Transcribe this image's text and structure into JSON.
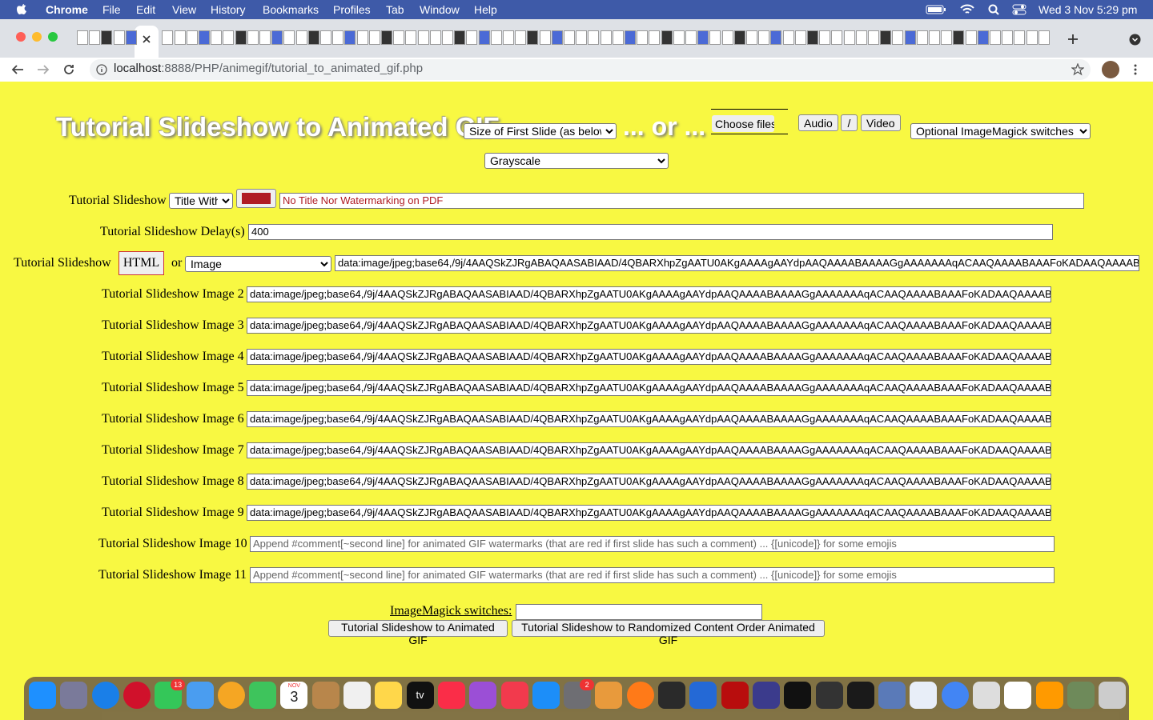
{
  "menubar": {
    "app": "Chrome",
    "items": [
      "File",
      "Edit",
      "View",
      "History",
      "Bookmarks",
      "Profiles",
      "Tab",
      "Window",
      "Help"
    ],
    "clock": "Wed 3 Nov  5:29 pm"
  },
  "browser": {
    "url_host": "localhost",
    "url_path": ":8888/PHP/animegif/tutorial_to_animated_gif.php"
  },
  "header": {
    "title": "Tutorial Slideshow to Animated GIF",
    "size_select": "Size of First Slide (as below)",
    "or_text": "... or ...",
    "choose_files": "Choose files",
    "audio": "Audio",
    "slash": "/",
    "video": "Video",
    "switches_select": "Optional ImageMagick switches ...",
    "effect_select": "Grayscale"
  },
  "form": {
    "title_row": {
      "label": "Tutorial Slideshow",
      "select": "Title With",
      "color": "#b01c24",
      "value": "No Title Nor Watermarking on PDF"
    },
    "delay_row": {
      "label": "Tutorial Slideshow Delay(s)",
      "value": "400"
    },
    "image1_row": {
      "label": "Tutorial Slideshow",
      "html_button": "HTML",
      "or": "or",
      "select": "Image",
      "value": "data:image/jpeg;base64,/9j/4AAQSkZJRgABAQAASABIAAD/4QBARXhpZgAATU0AKgAAAAgAAYdpAAQAAAABAAAAGgAAAAAAAqACAAQAAAABAAAFoKADAAQAAAABAAAA"
    },
    "image_rows": [
      {
        "label": "Tutorial Slideshow Image 2",
        "value": "data:image/jpeg;base64,/9j/4AAQSkZJRgABAQAASABIAAD/4QBARXhpZgAATU0AKgAAAAgAAYdpAAQAAAABAAAAGgAAAAAAAqACAAQAAAABAAAFoKADAAQAAAABAAAA"
      },
      {
        "label": "Tutorial Slideshow Image 3",
        "value": "data:image/jpeg;base64,/9j/4AAQSkZJRgABAQAASABIAAD/4QBARXhpZgAATU0AKgAAAAgAAYdpAAQAAAABAAAAGgAAAAAAAqACAAQAAAABAAAFoKADAAQAAAABAAAA"
      },
      {
        "label": "Tutorial Slideshow Image 4",
        "value": "data:image/jpeg;base64,/9j/4AAQSkZJRgABAQAASABIAAD/4QBARXhpZgAATU0AKgAAAAgAAYdpAAQAAAABAAAAGgAAAAAAAqACAAQAAAABAAAFoKADAAQAAAABAAAA"
      },
      {
        "label": "Tutorial Slideshow Image 5",
        "value": "data:image/jpeg;base64,/9j/4AAQSkZJRgABAQAASABIAAD/4QBARXhpZgAATU0AKgAAAAgAAYdpAAQAAAABAAAAGgAAAAAAAqACAAQAAAABAAAFoKADAAQAAAABAAAA"
      },
      {
        "label": "Tutorial Slideshow Image 6",
        "value": "data:image/jpeg;base64,/9j/4AAQSkZJRgABAQAASABIAAD/4QBARXhpZgAATU0AKgAAAAgAAYdpAAQAAAABAAAAGgAAAAAAAqACAAQAAAABAAAFoKADAAQAAAABAAAA"
      },
      {
        "label": "Tutorial Slideshow Image 7",
        "value": "data:image/jpeg;base64,/9j/4AAQSkZJRgABAQAASABIAAD/4QBARXhpZgAATU0AKgAAAAgAAYdpAAQAAAABAAAAGgAAAAAAAqACAAQAAAABAAAFoKADAAQAAAABAAAA"
      },
      {
        "label": "Tutorial Slideshow Image 8",
        "value": "data:image/jpeg;base64,/9j/4AAQSkZJRgABAQAASABIAAD/4QBARXhpZgAATU0AKgAAAAgAAYdpAAQAAAABAAAAGgAAAAAAAqACAAQAAAABAAAFoKADAAQAAAABAAAA"
      },
      {
        "label": "Tutorial Slideshow Image 9",
        "value": "data:image/jpeg;base64,/9j/4AAQSkZJRgABAQAASABIAAD/4QBARXhpZgAATU0AKgAAAAgAAYdpAAQAAAABAAAAGgAAAAAAAqACAAQAAAABAAAFoKADAAQAAAABAAAA"
      }
    ],
    "empty_rows": [
      {
        "label": "Tutorial Slideshow Image 10",
        "placeholder": "Append #comment[~second line] for animated GIF watermarks (that are red if first slide has such a comment) ... {[unicode]} for some emojis"
      },
      {
        "label": "Tutorial Slideshow Image 11",
        "placeholder": "Append #comment[~second line] for animated GIF watermarks (that are red if first slide has such a comment) ... {[unicode]} for some emojis"
      }
    ],
    "switches_label": "ImageMagick switches:",
    "submit": "Tutorial Slideshow to Animated GIF",
    "submit_random": "Tutorial Slideshow to Randomized Content Order Animated GIF"
  },
  "dock": {
    "calendar_month": "NOV",
    "calendar_day": "3",
    "messages_badge": "13",
    "prefs_badge": "2",
    "tv_label": "tv"
  }
}
